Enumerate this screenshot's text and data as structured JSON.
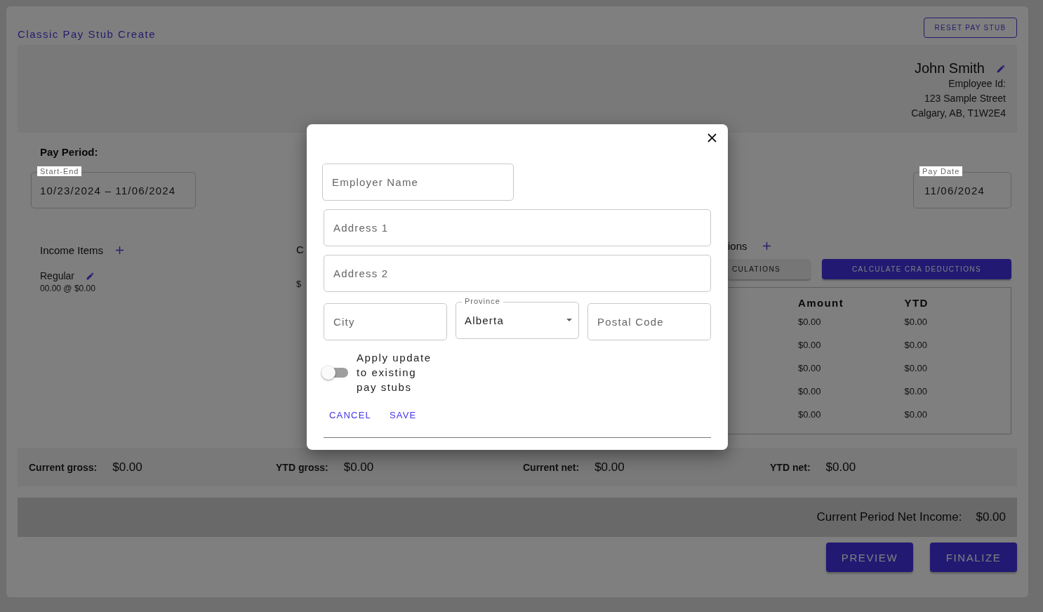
{
  "page": {
    "title": "Classic Pay Stub Create",
    "reset_button": "RESET PAY STUB"
  },
  "employee": {
    "name": "John Smith",
    "lines": [
      "Employee Id:",
      "123 Sample Street",
      "Calgary, AB, T1W2E4"
    ]
  },
  "pay_period": {
    "label": "Pay Period:",
    "range": {
      "label": "Start-End",
      "value": "10/23/2024 – 11/06/2024"
    },
    "pay_date": {
      "label": "Pay Date",
      "value": "11/06/2024"
    }
  },
  "income": {
    "title": "Income Items",
    "items": [
      {
        "name": "Regular",
        "detail": "00.00 @ $0.00"
      }
    ]
  },
  "middle_column": {
    "heading": "C",
    "value": "$"
  },
  "deductions": {
    "title": "ions",
    "buttons": [
      {
        "label": "CULATIONS",
        "kind": "secondary"
      },
      {
        "label": "CALCULATE CRA DEDUCTIONS",
        "kind": "primary"
      }
    ],
    "columns": [
      "Amount",
      "YTD"
    ],
    "rows": [
      [
        "$0.00",
        "$0.00"
      ],
      [
        "$0.00",
        "$0.00"
      ],
      [
        "$0.00",
        "$0.00"
      ],
      [
        "$0.00",
        "$0.00"
      ],
      [
        "$0.00",
        "$0.00"
      ]
    ]
  },
  "totals": [
    {
      "label": "Current gross:",
      "value": "$0.00"
    },
    {
      "label": "YTD gross:",
      "value": "$0.00"
    },
    {
      "label": "Current net:",
      "value": "$0.00"
    },
    {
      "label": "YTD net:",
      "value": "$0.00"
    }
  ],
  "net_income": {
    "label": "Current Period Net Income:",
    "value": "$0.00"
  },
  "actions": [
    "PREVIEW",
    "FINALIZE"
  ],
  "dialog": {
    "employer_name": {
      "placeholder": "Employer Name"
    },
    "address_1": {
      "placeholder": "Address 1"
    },
    "address_2": {
      "placeholder": "Address 2"
    },
    "city": {
      "placeholder": "City"
    },
    "province": {
      "label": "Province",
      "value": "Alberta"
    },
    "postal_code": {
      "placeholder": "Postal Code"
    },
    "toggle": {
      "label": "Apply update to existing pay stubs",
      "on": false
    },
    "buttons": [
      "CANCEL",
      "SAVE"
    ]
  }
}
